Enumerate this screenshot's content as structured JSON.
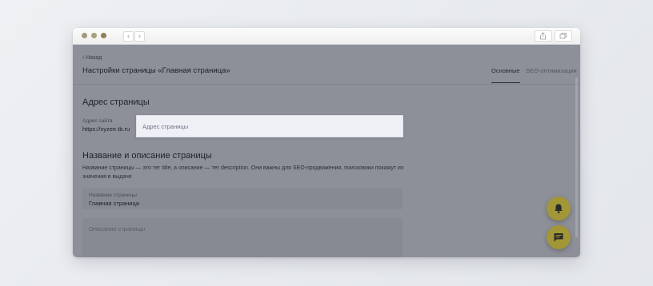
{
  "browser": {
    "traffic_light_colors": [
      "#a39a7d",
      "#a7a07c",
      "#8f7f5a"
    ],
    "icons": [
      "chevron-left-icon",
      "chevron-right-icon",
      "share-icon",
      "tabs-icon"
    ]
  },
  "header": {
    "back_label": "Назад",
    "title": "Настройки страницы «Главная страница»",
    "tabs": [
      {
        "label": "Основные",
        "active": true
      },
      {
        "label": "SEO-оптимизация",
        "active": false
      }
    ]
  },
  "address_section": {
    "heading": "Адрес страницы",
    "site_label": "Адрес сайта",
    "site_value": "https://xyzee.tb.ru"
  },
  "meta_section": {
    "heading": "Название и описание страницы",
    "description": "Название страницы — это тег title, а описание — тег description. Они важны для SEO-продвижения, поисковики покажут их значения в выдаче",
    "name_field": {
      "label": "Название страницы",
      "value": "Главная страница"
    },
    "description_field": {
      "placeholder": "Описание страницы"
    }
  },
  "highlight_input": {
    "placeholder": "Адрес страницы"
  },
  "fabs": {
    "notifications": "bell-icon",
    "chat": "chat-icon",
    "color": "#a19736"
  },
  "overlay_color": "#1e2234"
}
